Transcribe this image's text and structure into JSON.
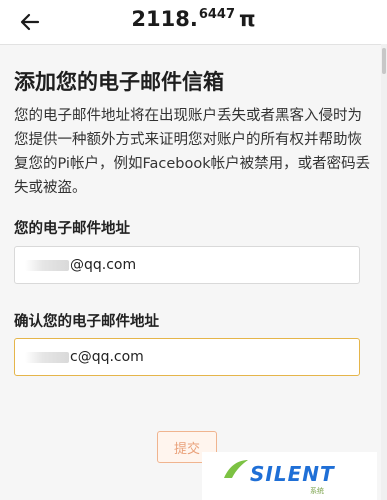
{
  "header": {
    "balance_int": "2118.",
    "balance_dec": "6447",
    "currency": "π"
  },
  "main": {
    "title": "添加您的电子邮件信箱",
    "description": "您的电子邮件地址将在出现账户丢失或者黑客入侵时为您提供一种额外方式来证明您对账户的所有权并帮助恢复您的Pi帐户，例如Facebook帐户被禁用，或者密码丢失或被盗。"
  },
  "email": {
    "label": "您的电子邮件地址",
    "value": "@qq.com"
  },
  "confirm": {
    "label": "确认您的电子邮件地址",
    "value": "c@qq.com"
  },
  "submit": {
    "label": "提交"
  },
  "watermark": {
    "text": "SILENT",
    "sub": "系统"
  },
  "colors": {
    "focus_border": "#e5b54a",
    "submit_text": "#e9a17a",
    "watermark": "#1f6fd6"
  }
}
